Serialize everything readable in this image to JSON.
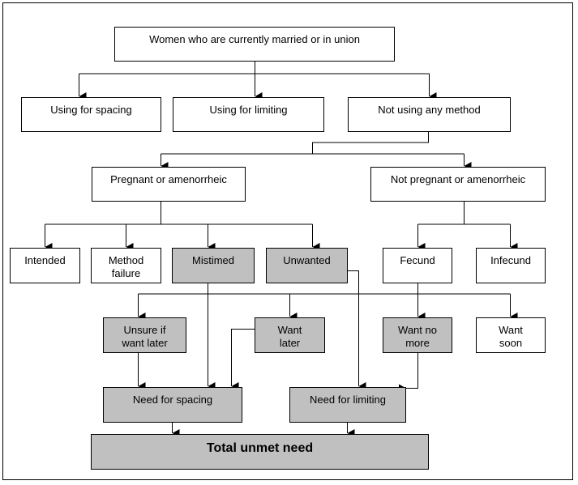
{
  "diagram": {
    "colors": {
      "shaded_fill": "#c0c0c0",
      "plain_fill": "#ffffff",
      "line": "#000000"
    },
    "nodes": {
      "root": {
        "label": "Women who are currently married or in union",
        "shaded": false
      },
      "using_spacing": {
        "label": "Using for spacing",
        "shaded": false
      },
      "using_limiting": {
        "label": "Using for limiting",
        "shaded": false
      },
      "not_using": {
        "label": "Not using any method",
        "shaded": false
      },
      "pregnant": {
        "label": "Pregnant or amenorrheic",
        "shaded": false
      },
      "not_pregnant": {
        "label": "Not pregnant or amenorrheic",
        "shaded": false
      },
      "intended": {
        "label": "Intended",
        "shaded": false
      },
      "method_failure": {
        "label": "Method\nfailure",
        "shaded": false
      },
      "mistimed": {
        "label": "Mistimed",
        "shaded": true
      },
      "unwanted": {
        "label": "Unwanted",
        "shaded": true
      },
      "fecund": {
        "label": "Fecund",
        "shaded": false
      },
      "infecund": {
        "label": "Infecund",
        "shaded": false
      },
      "unsure": {
        "label": "Unsure if\nwant later",
        "shaded": true
      },
      "want_later": {
        "label": "Want\nlater",
        "shaded": true
      },
      "want_no_more": {
        "label": "Want no\nmore",
        "shaded": true
      },
      "want_soon": {
        "label": "Want\nsoon",
        "shaded": false
      },
      "need_spacing": {
        "label": "Need for spacing",
        "shaded": true
      },
      "need_limiting": {
        "label": "Need for limiting",
        "shaded": true
      },
      "total": {
        "label": "Total unmet need",
        "shaded": true
      }
    },
    "edges": [
      [
        "root",
        "using_spacing"
      ],
      [
        "root",
        "using_limiting"
      ],
      [
        "root",
        "not_using"
      ],
      [
        "not_using",
        "pregnant"
      ],
      [
        "not_using",
        "not_pregnant"
      ],
      [
        "pregnant",
        "intended"
      ],
      [
        "pregnant",
        "method_failure"
      ],
      [
        "pregnant",
        "mistimed"
      ],
      [
        "pregnant",
        "unwanted"
      ],
      [
        "not_pregnant",
        "fecund"
      ],
      [
        "not_pregnant",
        "infecund"
      ],
      [
        "fecund",
        "unsure"
      ],
      [
        "fecund",
        "want_later"
      ],
      [
        "fecund",
        "want_no_more"
      ],
      [
        "fecund",
        "want_soon"
      ],
      [
        "unsure",
        "need_spacing"
      ],
      [
        "mistimed",
        "need_spacing"
      ],
      [
        "want_later",
        "need_spacing"
      ],
      [
        "unwanted",
        "need_limiting"
      ],
      [
        "want_no_more",
        "need_limiting"
      ],
      [
        "need_spacing",
        "total"
      ],
      [
        "need_limiting",
        "total"
      ]
    ]
  }
}
